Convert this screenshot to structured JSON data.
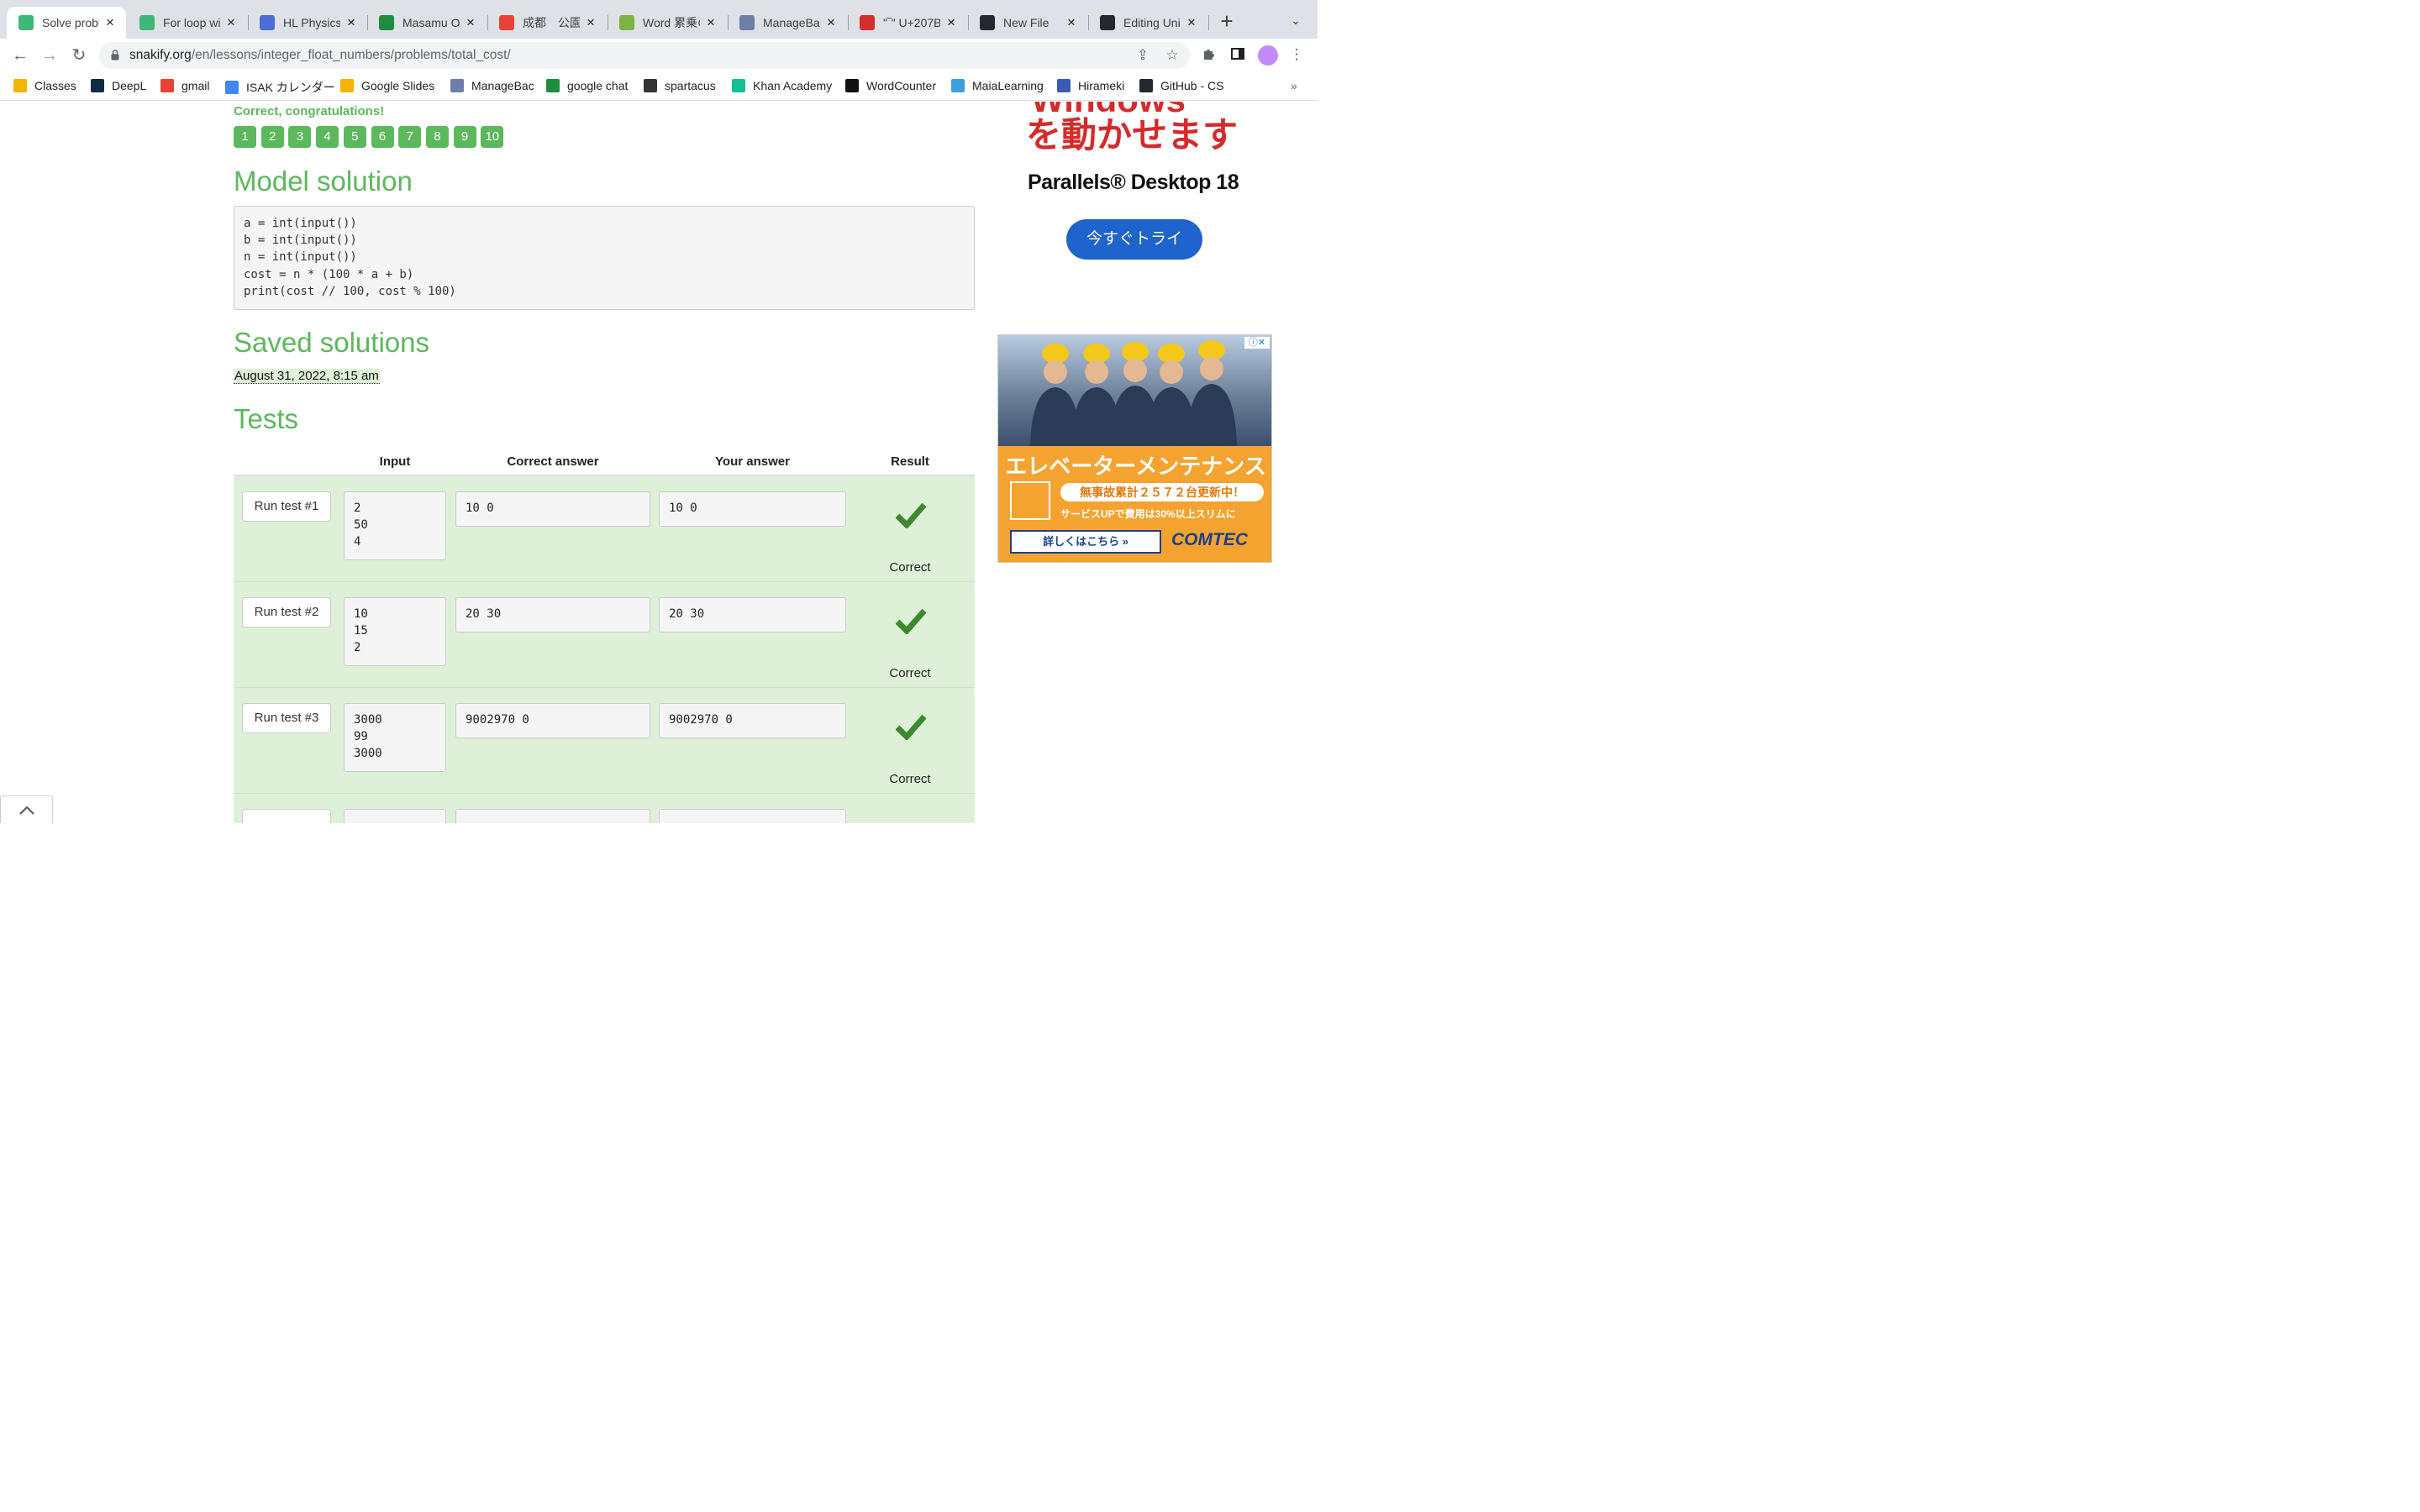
{
  "browser": {
    "tabs": [
      {
        "title": "Solve proble",
        "active": true,
        "favicon_color": "#3cb878",
        "favicon": "snake-icon"
      },
      {
        "title": "For loop wit",
        "active": false,
        "favicon_color": "#3cb878",
        "favicon": "snake-icon"
      },
      {
        "title": "HL Physics",
        "active": false,
        "favicon_color": "#4a6fd8",
        "favicon": "classroom-icon"
      },
      {
        "title": "Masamu Os",
        "active": false,
        "favicon_color": "#1e8e3e",
        "favicon": "sheets-icon"
      },
      {
        "title": "成都　公園 -",
        "active": false,
        "favicon_color": "#ea4335",
        "favicon": "maps-pin-icon"
      },
      {
        "title": "Word 累乗の",
        "active": false,
        "favicon_color": "#7cb342",
        "favicon": "app-icon"
      },
      {
        "title": "ManageBac",
        "active": false,
        "favicon_color": "#6d7ea8",
        "favicon": "managebac-icon"
      },
      {
        "title": "\"‾\" U+207B",
        "active": false,
        "favicon_color": "#d32f2f",
        "favicon": "unicode-icon"
      },
      {
        "title": "New File",
        "active": false,
        "favicon_color": "#24292f",
        "favicon": "github-icon"
      },
      {
        "title": "Editing Unit",
        "active": false,
        "favicon_color": "#24292f",
        "favicon": "github-icon"
      }
    ],
    "url_host": "snakify.org",
    "url_path": "/en/lessons/integer_float_numbers/problems/total_cost/",
    "bookmarks": [
      {
        "label": "Classes",
        "color": "#f4b400"
      },
      {
        "label": "DeepL",
        "color": "#0f2b46"
      },
      {
        "label": "gmail",
        "color": "#ea4335"
      },
      {
        "label": "ISAK カレンダー",
        "color": "#4285f4"
      },
      {
        "label": "Google Slides",
        "color": "#f4b400"
      },
      {
        "label": "ManageBac",
        "color": "#6d7ea8"
      },
      {
        "label": "google chat",
        "color": "#1e8e3e"
      },
      {
        "label": "spartacus",
        "color": "#333333"
      },
      {
        "label": "Khan Academy",
        "color": "#14bf96"
      },
      {
        "label": "WordCounter",
        "color": "#111111"
      },
      {
        "label": "MaiaLearning",
        "color": "#3aa0e0"
      },
      {
        "label": "Hirameki",
        "color": "#3b5bb3"
      },
      {
        "label": "GitHub - CS",
        "color": "#24292f"
      }
    ],
    "bookmarks_more": "»"
  },
  "page": {
    "congrats": "Correct, congratulations!",
    "problems": [
      "1",
      "2",
      "3",
      "4",
      "5",
      "6",
      "7",
      "8",
      "9",
      "10"
    ],
    "model_solution_title": "Model solution",
    "code": "a = int(input())\nb = int(input())\nn = int(input())\ncost = n * (100 * a + b)\nprint(cost // 100, cost % 100)",
    "saved_solutions_title": "Saved solutions",
    "saved_solution_date": "August 31, 2022, 8:15 am",
    "tests_title": "Tests",
    "table_headers": {
      "input": "Input",
      "correct_answer": "Correct answer",
      "your_answer": "Your answer",
      "result": "Result"
    },
    "tests": [
      {
        "button": "Run test #1",
        "input": "2\n50\n4",
        "correct": "10 0",
        "yours": "10 0",
        "result": "Correct"
      },
      {
        "button": "Run test #2",
        "input": "10\n15\n2",
        "correct": "20 30",
        "yours": "20 30",
        "result": "Correct"
      },
      {
        "button": "Run test #3",
        "input": "3000\n99\n3000",
        "correct": "9002970 0",
        "yours": "9002970 0",
        "result": "Correct"
      }
    ],
    "colors": {
      "accent": "#5cb85c",
      "row_success": "#dff0d8",
      "check": "#3c8a2e"
    }
  },
  "ads": {
    "top": {
      "headline_clipped": "Windows",
      "headline": "を動かせます",
      "brand": "Parallels® Desktop 18",
      "cta": "今すぐトライ"
    },
    "right": {
      "headline": "エレベーターメンテナンス",
      "pill": "無事故累計２５７２台更新中！",
      "sub": "サービスUPで費用は30%以上スリムに",
      "button": "詳しくはこちら »",
      "logo": "COMTEC"
    }
  }
}
